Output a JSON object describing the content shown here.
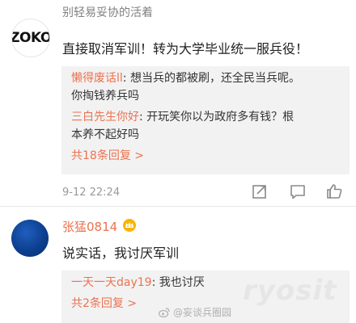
{
  "comment_1": {
    "avatar_text": "ZOKO",
    "username": "别轻易妥协的活着",
    "text": "直接取消军训！转为大学毕业统一服兵役！",
    "replies": [
      {
        "user": "懒得废话ll",
        "text": ": 想当兵的都被刷，还全民当兵呢。",
        "continuation": "你掏钱养兵吗"
      },
      {
        "user": "三白先生你好",
        "text": ": 开玩笑你以为政府多有钱？根",
        "continuation": "本养不起好吗"
      }
    ],
    "more_replies": "共18条回复 >",
    "timestamp": "9-12 22:24",
    "icons": [
      "share-icon",
      "comment-icon",
      "like-icon"
    ]
  },
  "comment_2": {
    "username": "张猛0814",
    "badge_icon": "vip-crown-icon",
    "text": "说实话，我讨厌军训",
    "replies": [
      {
        "user": "一天一天day19",
        "text": ": 我也讨厌"
      }
    ],
    "more_replies": "共2条回复 >"
  },
  "watermark": {
    "text": "@妄谈兵圈园",
    "faded": "ryosit"
  },
  "colors": {
    "accent": "#eb7350",
    "reply_bg": "#f2f2f2",
    "meta": "#999999"
  }
}
